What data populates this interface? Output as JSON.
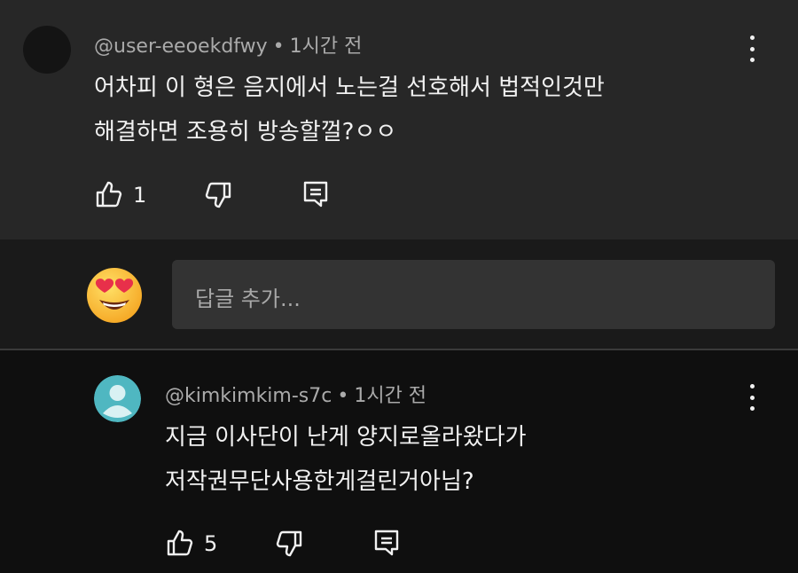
{
  "comments": [
    {
      "author": "@user-eeoekdfwy",
      "time": "1시간 전",
      "lines": [
        "어차피 이 형은 음지에서 노는걸 선호해서 법적인것만",
        "해결하면 조용히 방송할껄?ㅇㅇ"
      ],
      "likes": "1"
    },
    {
      "author": "@kimkimkim-s7c",
      "time": "1시간 전",
      "lines": [
        "지금 이사단이 난게 양지로올라왔다가",
        "저작권무단사용한게걸린거아님?"
      ],
      "likes": "5"
    }
  ],
  "reply": {
    "placeholder": "답글 추가..."
  },
  "icons": {
    "like": "thumbs-up-icon",
    "dislike": "thumbs-down-icon",
    "reply": "reply-icon",
    "more": "more-vert-icon",
    "emoji": "heart-eyes-emoji"
  },
  "colors": {
    "top_comment_bg": "#272727",
    "page_bg": "#0f0f0f",
    "input_bg": "#333333",
    "avatar2": "#4fb7c1"
  }
}
